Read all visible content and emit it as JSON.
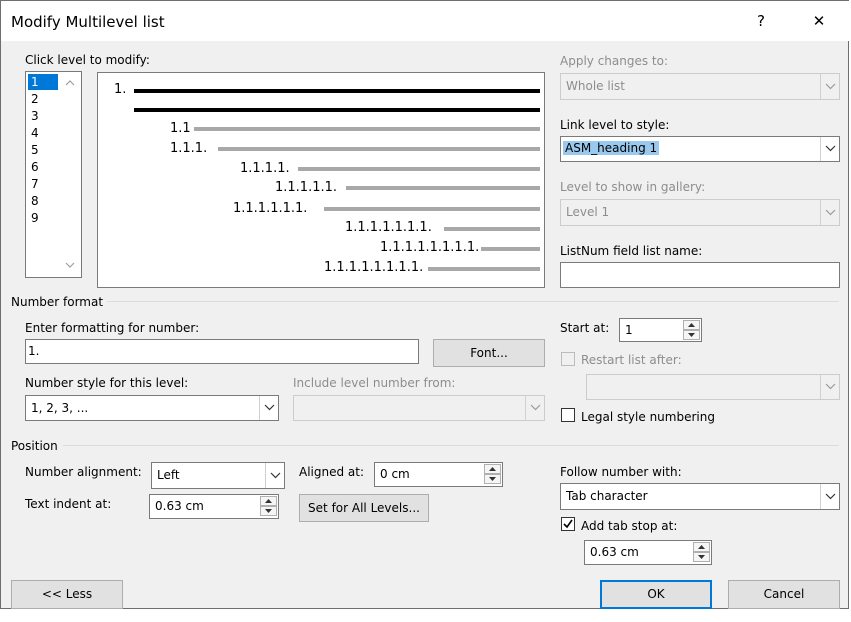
{
  "dialog": {
    "title": "Modify Multilevel list",
    "help_glyph": "?",
    "close_glyph": "✕"
  },
  "levels": {
    "label": "Click level to modify:",
    "items": [
      "1",
      "2",
      "3",
      "4",
      "5",
      "6",
      "7",
      "8",
      "9"
    ],
    "selected": "1"
  },
  "preview": {
    "numbers": [
      "1.",
      "1.1",
      "1.1.1.",
      "1.1.1.1.",
      "1.1.1.1.1.",
      "1.1.1.1.1.1.",
      "1.1.1.1.1.1.1.",
      "1.1.1.1.1.1.1.1.",
      "1.1.1.1.1.1.1.1."
    ]
  },
  "apply_changes": {
    "label": "Apply changes to:",
    "value": "Whole list"
  },
  "link_level": {
    "label": "Link level to style:",
    "value": "ASM_heading 1"
  },
  "gallery_level": {
    "label": "Level to show in gallery:",
    "value": "Level 1"
  },
  "listnum": {
    "label": "ListNum field list name:",
    "value": ""
  },
  "number_format": {
    "section": "Number format",
    "enter_label": "Enter formatting for number:",
    "enter_value": "1.",
    "font_button": "Font...",
    "style_label": "Number style for this level:",
    "style_value": "1, 2, 3, ...",
    "include_label": "Include level number from:",
    "include_value": ""
  },
  "start_at": {
    "label": "Start at:",
    "value": "1"
  },
  "restart": {
    "label": "Restart list after:",
    "value": ""
  },
  "legal": {
    "label": "Legal style numbering",
    "checked": false
  },
  "position": {
    "section": "Position",
    "alignment_label": "Number alignment:",
    "alignment_value": "Left",
    "aligned_at_label": "Aligned at:",
    "aligned_at_value": "0 cm",
    "text_indent_label": "Text indent at:",
    "text_indent_value": "0.63 cm",
    "set_all_button": "Set for All Levels..."
  },
  "follow": {
    "label": "Follow number with:",
    "value": "Tab character"
  },
  "tab_stop": {
    "label": "Add tab stop at:",
    "checked": true,
    "value": "0.63 cm"
  },
  "footer": {
    "less_button": "<< Less",
    "ok_button": "OK",
    "cancel_button": "Cancel"
  },
  "colors": {
    "accent": "#0078d7",
    "selection": "#99c9ef",
    "disabled_text": "#8d8d8d"
  }
}
